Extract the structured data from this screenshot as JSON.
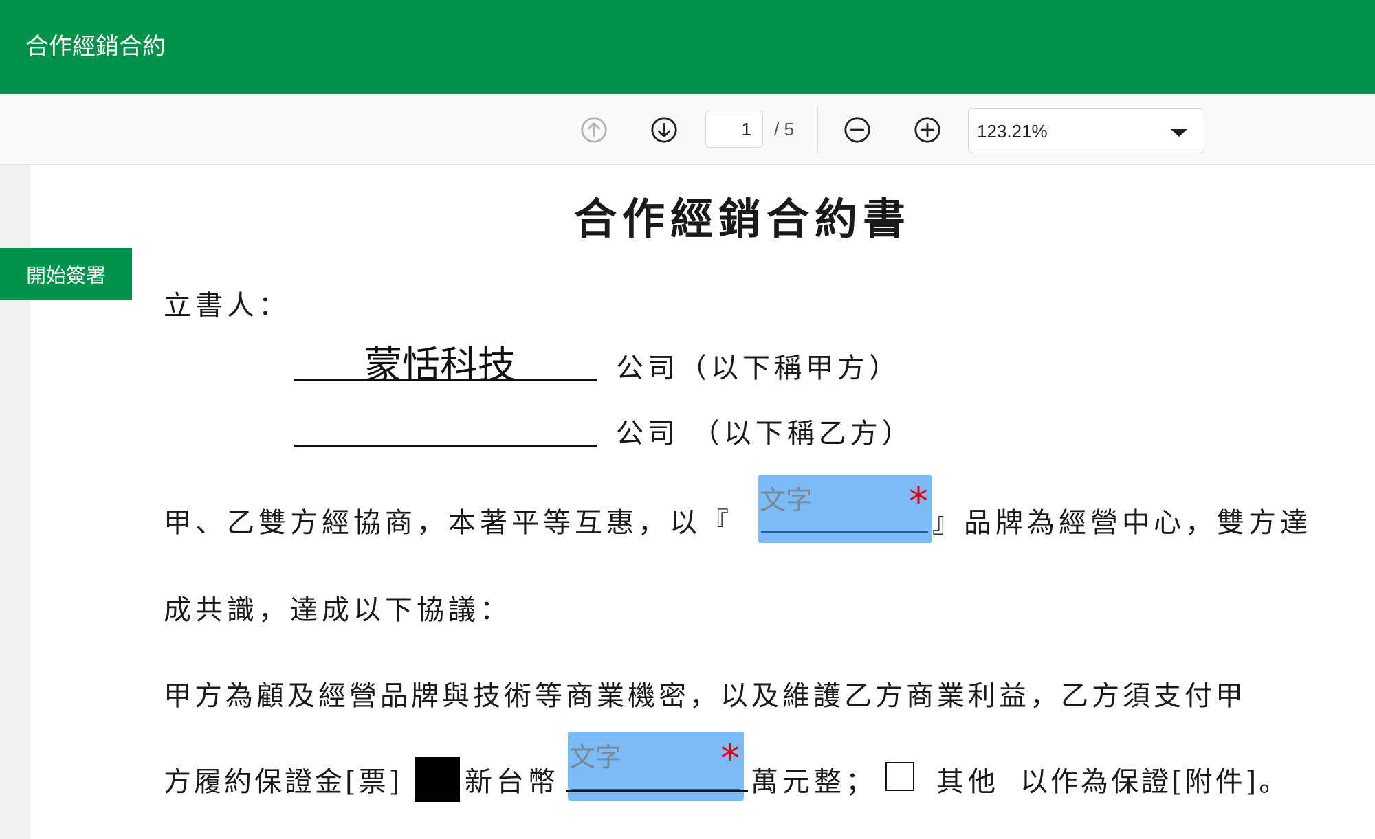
{
  "header": {
    "title": "合作經銷合約"
  },
  "toolbar": {
    "page_current": "1",
    "page_total": "/ 5",
    "zoom": "123.21%",
    "icons": [
      "arrow-up-circle-icon",
      "arrow-down-circle-icon",
      "zoom-out-icon",
      "zoom-in-icon",
      "chevron-down-icon"
    ]
  },
  "sidebar": {
    "sign_label": "開始簽署"
  },
  "document": {
    "title": "合作經銷合約書",
    "signatory_label": "立書人：",
    "party_a_name": "蒙恬科技",
    "party_a_suffix": "公司（以下稱甲方）",
    "party_b_suffix": "公司 （以下稱乙方）",
    "para1_line1_pre": "甲、乙雙方經協商，本著平等互惠，以『",
    "para1_line1_post": "』品牌為經營中心，雙方達",
    "para1_line2": "成共識，達成以下協議：",
    "para2_line1": "甲方為顧及經營品牌與技術等商業機密，以及維護乙方商業利益，乙方須支付甲",
    "para2_line2_pre": "方履約保證金[票]",
    "para2_line2_mid": "新台幣",
    "para2_line2_post": "萬元整；",
    "para2_line2_other": "其他",
    "para2_line2_end": "以作為保證[附件]。",
    "field_placeholder": "文字",
    "required_mark": "*"
  },
  "colors": {
    "header_green": "#009249",
    "field_blue": "#7bbcf7",
    "required_red": "#e8000d"
  }
}
